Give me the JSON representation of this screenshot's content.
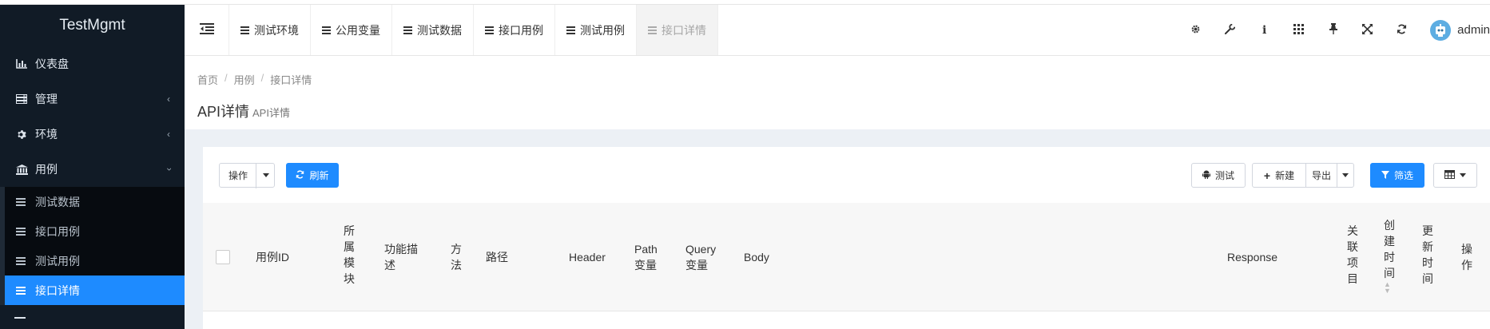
{
  "app": {
    "title": "TestMgmt"
  },
  "sidebar": {
    "items": [
      {
        "label": "仪表盘",
        "icon": "bar-chart-icon"
      },
      {
        "label": "管理",
        "icon": "server-icon"
      },
      {
        "label": "环境",
        "icon": "gear-icon"
      },
      {
        "label": "用例",
        "icon": "bank-icon"
      }
    ],
    "sub_items": [
      {
        "label": "测试数据"
      },
      {
        "label": "接口用例"
      },
      {
        "label": "测试用例"
      },
      {
        "label": "接口详情",
        "active": true
      }
    ]
  },
  "topnav": {
    "tabs": [
      {
        "label": "测试环境"
      },
      {
        "label": "公用变量"
      },
      {
        "label": "测试数据"
      },
      {
        "label": "接口用例"
      },
      {
        "label": "测试用例"
      },
      {
        "label": "接口详情",
        "active": true
      }
    ],
    "user": {
      "name": "admin"
    }
  },
  "breadcrumb": {
    "home": "首页",
    "section": "用例",
    "current": "接口详情"
  },
  "page": {
    "title": "API详情",
    "subtitle": "API详情"
  },
  "toolbar": {
    "action_label": "操作",
    "refresh_label": "刷新",
    "test_label": "测试",
    "new_label": "新建",
    "export_label": "导出",
    "filter_label": "筛选"
  },
  "table": {
    "headers": {
      "case_id": "用例ID",
      "module": "所属模块",
      "description": "功能描述",
      "method": "方法",
      "path": "路径",
      "header": "Header",
      "path_vars": "Path变量",
      "query_vars": "Query变量",
      "body": "Body",
      "response": "Response",
      "project": "关联项目",
      "created": "创建时间",
      "updated": "更新时间",
      "actions": "操作"
    }
  },
  "colors": {
    "accent": "#1e8bff",
    "sidebar_bg": "#111b26"
  }
}
